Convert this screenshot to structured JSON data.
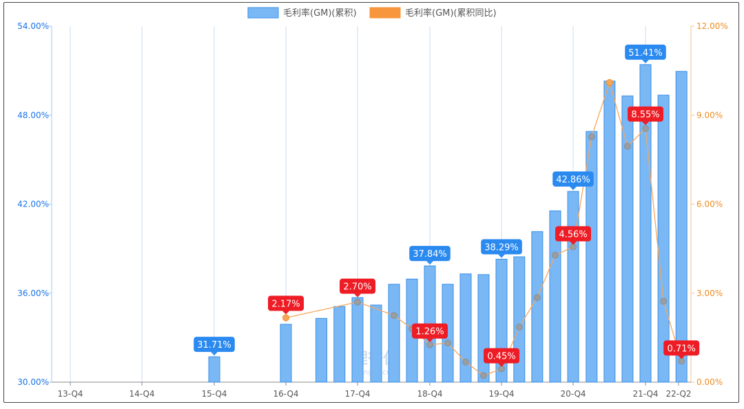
{
  "legend": {
    "items": [
      {
        "label": "毛利率(GM)(累积)",
        "color": "#7ab8f5",
        "border": "#3a8ee6"
      },
      {
        "label": "毛利率(GM)(累积同比)",
        "color": "#f7963c",
        "border": "#f7963c"
      }
    ]
  },
  "watermark": {
    "logo_text": "理杏仁",
    "site": "lixinger.com"
  },
  "chart_data": {
    "type": "bar",
    "x_tick_labels": [
      "13-Q4",
      "14-Q4",
      "15-Q4",
      "16-Q4",
      "17-Q4",
      "18-Q4",
      "19-Q4",
      "20-Q4",
      "21-Q4",
      "22-Q2"
    ],
    "left_axis": {
      "min": 30,
      "max": 54,
      "ticks": [
        "30.00%",
        "36.00%",
        "42.00%",
        "48.00%",
        "54.00%"
      ],
      "color": "#1a73e8"
    },
    "right_axis": {
      "min": 0,
      "max": 12,
      "ticks": [
        "0.00%",
        "3.00%",
        "6.00%",
        "9.00%",
        "12.00%"
      ],
      "color": "#f08c1e"
    },
    "grid": "vertical",
    "legend_position": "top-center",
    "series": [
      {
        "name": "毛利率(GM)(累积)",
        "kind": "bar",
        "axis": "left",
        "points": [
          {
            "period": "15-Q4",
            "value": 31.71,
            "label": "31.71%"
          },
          {
            "period": "16-Q4",
            "value": 33.9,
            "label": ""
          },
          {
            "period": "17-Q2",
            "value": 34.3,
            "label": ""
          },
          {
            "period": "17-Q3",
            "value": 35.1,
            "label": ""
          },
          {
            "period": "17-Q4",
            "value": 35.7,
            "label": ""
          },
          {
            "period": "18-Q1",
            "value": 35.2,
            "label": ""
          },
          {
            "period": "18-Q2",
            "value": 36.6,
            "label": ""
          },
          {
            "period": "18-Q3",
            "value": 36.95,
            "label": ""
          },
          {
            "period": "18-Q4",
            "value": 37.84,
            "label": "37.84%"
          },
          {
            "period": "19-Q1",
            "value": 36.6,
            "label": ""
          },
          {
            "period": "19-Q2",
            "value": 37.3,
            "label": ""
          },
          {
            "period": "19-Q3",
            "value": 37.25,
            "label": ""
          },
          {
            "period": "19-Q4",
            "value": 38.29,
            "label": "38.29%"
          },
          {
            "period": "20-Q1",
            "value": 38.45,
            "label": ""
          },
          {
            "period": "20-Q2",
            "value": 40.15,
            "label": ""
          },
          {
            "period": "20-Q3",
            "value": 41.55,
            "label": ""
          },
          {
            "period": "20-Q4",
            "value": 42.86,
            "label": "42.86%"
          },
          {
            "period": "21-Q1",
            "value": 46.9,
            "label": ""
          },
          {
            "period": "21-Q2",
            "value": 50.3,
            "label": ""
          },
          {
            "period": "21-Q3",
            "value": 49.3,
            "label": ""
          },
          {
            "period": "21-Q4",
            "value": 51.41,
            "label": "51.41%"
          },
          {
            "period": "22-Q1",
            "value": 49.35,
            "label": ""
          },
          {
            "period": "22-Q2",
            "value": 50.95,
            "label": ""
          }
        ]
      },
      {
        "name": "毛利率(GM)(累积同比)",
        "kind": "line",
        "axis": "right",
        "points": [
          {
            "period": "16-Q4",
            "value": 2.17,
            "label": "2.17%"
          },
          {
            "period": "17-Q4",
            "value": 2.7,
            "label": "2.70%"
          },
          {
            "period": "18-Q2",
            "value": 2.25,
            "label": ""
          },
          {
            "period": "18-Q3",
            "value": 1.8,
            "label": ""
          },
          {
            "period": "18-Q4",
            "value": 1.26,
            "label": "1.26%"
          },
          {
            "period": "19-Q1",
            "value": 1.32,
            "label": ""
          },
          {
            "period": "19-Q2",
            "value": 0.68,
            "label": ""
          },
          {
            "period": "19-Q3",
            "value": 0.22,
            "label": ""
          },
          {
            "period": "19-Q4",
            "value": 0.45,
            "label": "0.45%"
          },
          {
            "period": "20-Q1",
            "value": 1.86,
            "label": ""
          },
          {
            "period": "20-Q2",
            "value": 2.85,
            "label": ""
          },
          {
            "period": "20-Q3",
            "value": 4.28,
            "label": ""
          },
          {
            "period": "20-Q4",
            "value": 4.56,
            "label": "4.56%"
          },
          {
            "period": "21-Q1",
            "value": 8.27,
            "label": ""
          },
          {
            "period": "21-Q2",
            "value": 10.1,
            "label": ""
          },
          {
            "period": "21-Q3",
            "value": 7.95,
            "label": ""
          },
          {
            "period": "21-Q4",
            "value": 8.55,
            "label": "8.55%"
          },
          {
            "period": "22-Q1",
            "value": 2.73,
            "label": ""
          },
          {
            "period": "22-Q2",
            "value": 0.71,
            "label": "0.71%"
          }
        ]
      }
    ]
  }
}
